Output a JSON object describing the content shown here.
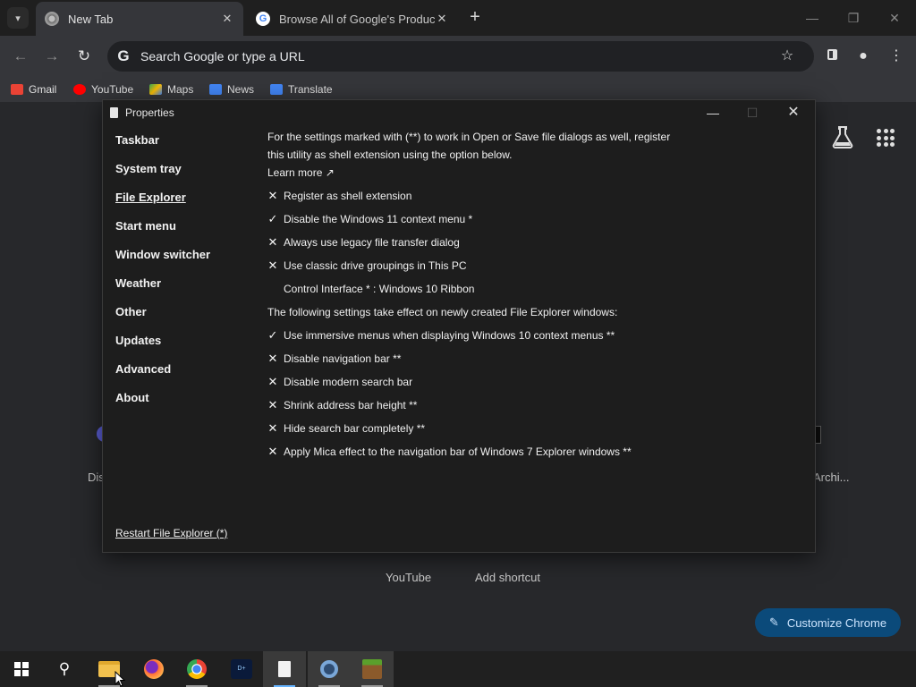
{
  "browser": {
    "tabs": [
      {
        "label": "New Tab",
        "icon": "chrome-icon",
        "active": true
      },
      {
        "label": "Browse All of Google's Products & Services",
        "icon": "google-icon",
        "active": false
      }
    ],
    "omnibox_placeholder": "Search Google or type a URL",
    "bookmarks": [
      {
        "label": "Gmail",
        "color": "#ea4335"
      },
      {
        "label": "YouTube",
        "color": "#ff0000"
      },
      {
        "label": "Maps",
        "color": "#34a853"
      },
      {
        "label": "News",
        "color": "#4285f4"
      },
      {
        "label": "Translate",
        "color": "#4285f4"
      }
    ]
  },
  "ntp": {
    "shortcut_partial_left": "Dis",
    "shortcut_partial_right": "Archi...",
    "shortcut_youtube": "YouTube",
    "shortcut_add": "Add shortcut",
    "customize_label": "Customize Chrome"
  },
  "properties": {
    "title": "Properties",
    "sidebar": [
      {
        "label": "Taskbar",
        "active": false
      },
      {
        "label": "System tray",
        "active": false
      },
      {
        "label": "File Explorer",
        "active": true
      },
      {
        "label": "Start menu",
        "active": false
      },
      {
        "label": "Window switcher",
        "active": false
      },
      {
        "label": "Weather",
        "active": false
      },
      {
        "label": "Other",
        "active": false
      },
      {
        "label": "Updates",
        "active": false
      },
      {
        "label": "Advanced",
        "active": false
      },
      {
        "label": "About",
        "active": false
      }
    ],
    "intro_line1": "For the settings marked with (**) to work in Open or Save file dialogs as well, register",
    "intro_line2": "this utility as shell extension using the option below.",
    "learn_more": "Learn more ↗",
    "options_a": [
      {
        "label": "Register as shell extension",
        "checked": false
      },
      {
        "label": "Disable the Windows 11 context menu *",
        "checked": true
      },
      {
        "label": "Always use legacy file transfer dialog",
        "checked": false
      },
      {
        "label": "Use classic drive groupings in This PC",
        "checked": false
      }
    ],
    "control_interface": "Control Interface * : Windows 10 Ribbon",
    "section_note": "The following settings take effect on newly created File Explorer windows:",
    "options_b": [
      {
        "label": "Use immersive menus when displaying Windows 10 context menus **",
        "checked": true
      },
      {
        "label": "Disable navigation bar **",
        "checked": false
      },
      {
        "label": "Disable modern search bar",
        "checked": false
      },
      {
        "label": "Shrink address bar height **",
        "checked": false
      },
      {
        "label": "Hide search bar completely **",
        "checked": false
      },
      {
        "label": "Apply Mica effect to the navigation bar of Windows 7 Explorer windows **",
        "checked": false
      }
    ],
    "restart_link": "Restart File Explorer (*)"
  },
  "taskbar": {
    "apps": [
      "start-icon",
      "search-icon",
      "file-explorer-icon",
      "firefox-icon",
      "chrome-icon",
      "disney-plus-icon",
      "properties-app-icon",
      "settings-icon",
      "minecraft-icon"
    ]
  }
}
